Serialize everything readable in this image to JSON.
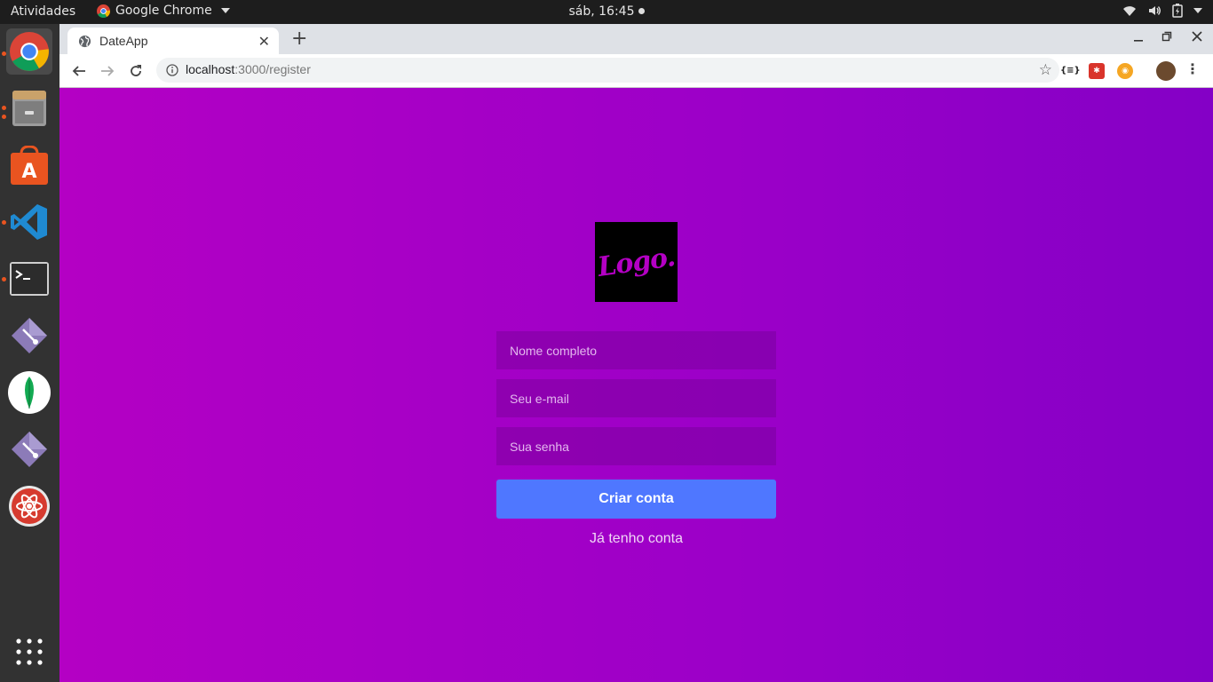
{
  "topbar": {
    "activities": "Atividades",
    "app_name": "Google Chrome",
    "clock": "sáb, 16:45",
    "icons": [
      "wifi-icon",
      "volume-icon",
      "battery-icon",
      "system-menu-caret-icon"
    ]
  },
  "dock": {
    "apps": [
      "chrome-icon",
      "files-icon",
      "software-center-icon",
      "vscode-icon",
      "terminal-icon",
      "git-app-icon",
      "mongodb-icon",
      "git-app-icon",
      "atom-icon"
    ],
    "show_apps_icon": "grid-icon"
  },
  "browser": {
    "tab_title": "DateApp",
    "url_host": "localhost",
    "url_path": ":3000/register",
    "extensions": [
      "{≡}",
      "ext-red-icon",
      "ext-orange-icon"
    ]
  },
  "page": {
    "logo_text": "Logo.",
    "form": {
      "name_placeholder": "Nome completo",
      "email_placeholder": "Seu e-mail",
      "password_placeholder": "Sua senha",
      "submit_label": "Criar conta",
      "login_link": "Já tenho conta"
    }
  },
  "colors": {
    "bg_start": "#b400c4",
    "bg_end": "#8400c6",
    "button": "#4f77ff"
  }
}
